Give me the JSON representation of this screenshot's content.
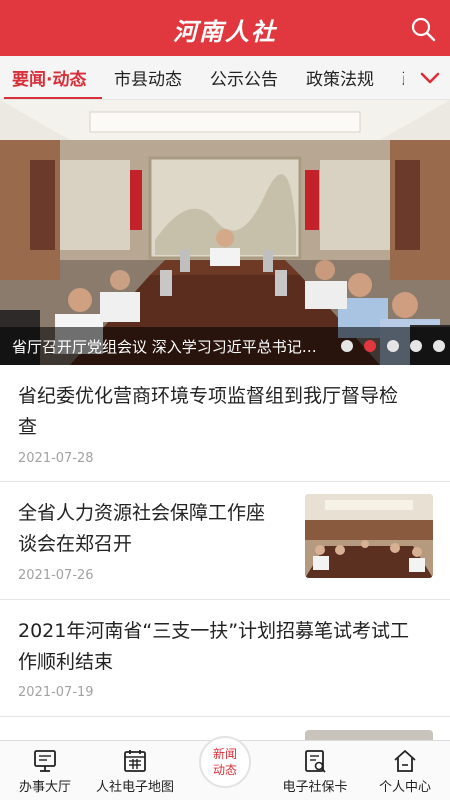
{
  "header": {
    "title": "河南人社",
    "icon": "search-icon"
  },
  "tabs": [
    {
      "label": "要闻·动态",
      "active": true
    },
    {
      "label": "市县动态"
    },
    {
      "label": "公示公告"
    },
    {
      "label": "政策法规"
    },
    {
      "label": "政"
    }
  ],
  "banner": {
    "caption": "省厅召开厅党组会议 深入学习习近平总书记…",
    "slide_count": 5,
    "active_slide": 2
  },
  "news": [
    {
      "title_lines": [
        "省纪委优化营商环境专项监督组到我厅督导检",
        "查"
      ],
      "date": "2021-07-28",
      "has_thumbnail": false
    },
    {
      "title_lines": [
        "全省人力资源社会保障工作座",
        "谈会在郑召开"
      ],
      "date": "2021-07-26",
      "has_thumbnail": true
    },
    {
      "title_lines": [
        "2021年河南省“三支一扶”计划招募笔试考试工",
        "作顺利结束"
      ],
      "date": "2021-07-19",
      "has_thumbnail": false
    }
  ],
  "bottom_nav": {
    "items": [
      {
        "label": "办事大厅",
        "icon": "monitor-icon"
      },
      {
        "label": "人社电子地图",
        "icon": "map-icon"
      },
      {
        "label": "电子社保卡",
        "icon": "card-icon"
      },
      {
        "label": "个人中心",
        "icon": "home-icon"
      }
    ],
    "center": {
      "line1": "新闻",
      "line2": "动态"
    }
  },
  "colors": {
    "brand_red": "#e0383e",
    "date_gray": "#a2a2a2"
  }
}
